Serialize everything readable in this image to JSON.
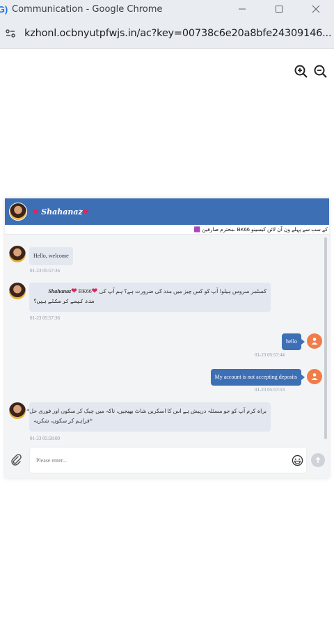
{
  "window": {
    "title": "Communication - Google Chrome",
    "url": "kzhonl.ocbnyutpfwjs.in/ac?key=00738c6e20a8bfe24309146..."
  },
  "chat": {
    "agent_name": "Shahanaz",
    "marquee": "کے سب سے پہلے ون آن لائن کیسینو BK66 ،محترم صارفین 🟪",
    "input_placeholder": "Please enter...",
    "messages": [
      {
        "side": "left",
        "text": "Hello, welcome",
        "time": "01-23 05:57:36"
      },
      {
        "side": "left",
        "text_prefix": "BK66",
        "agent": "Shahanaz",
        "text_line1": "کسٹمر سروس ہیلو! آپ کو کس چیز میں مدد کی ضرورت ہے؟ ہم آپ کی",
        "text_line2": "مدد کیسے کر سکتے ہیں؟",
        "time": "01-23 05:57:36"
      },
      {
        "side": "right",
        "text": "hello",
        "time": "01-23 05:57:44"
      },
      {
        "side": "right",
        "text": "My account is not accepting deposits",
        "time": "01-23 05:57:53"
      },
      {
        "side": "left",
        "text_line1": "براہ کرم آپ کو جو مسئلہ درپیش ہے اس کا اسکرین شاٹ بھیجیں، تاکہ میں چیک کر سکوں اور فوری حل*",
        "text_line2": "*فراہم کر سکوں، شکریہ",
        "time": "01-23 05:58:09"
      }
    ]
  },
  "colors": {
    "header_blue": "#3d6fb5",
    "user_avatar": "#f07c4a",
    "bubble_left": "#e3e7ef"
  },
  "icons": [
    "chrome-app-icon",
    "site-settings-icon",
    "zoom-in-icon",
    "zoom-out-icon",
    "attachment-icon",
    "emoji-icon",
    "send-icon",
    "user-icon"
  ]
}
